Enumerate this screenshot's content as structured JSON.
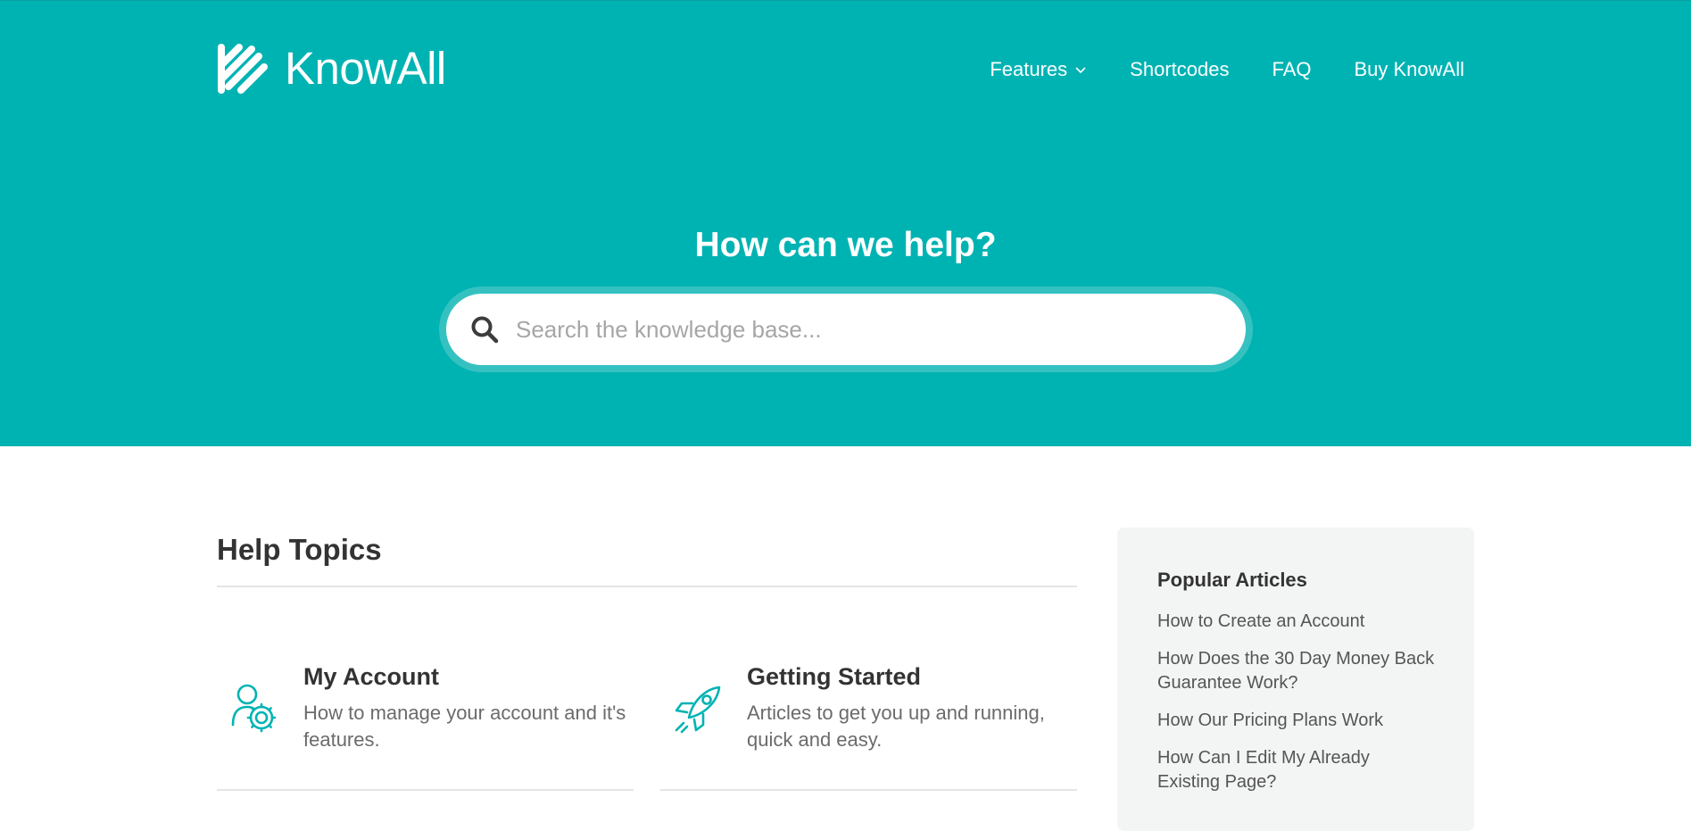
{
  "brand": {
    "name": "KnowAll",
    "color": "#00b3b3"
  },
  "nav": {
    "items": [
      {
        "label": "Features",
        "has_dropdown": true
      },
      {
        "label": "Shortcodes"
      },
      {
        "label": "FAQ"
      },
      {
        "label": "Buy KnowAll"
      }
    ]
  },
  "hero": {
    "title": "How can we help?",
    "search": {
      "placeholder": "Search the knowledge base...",
      "value": "",
      "icon": "search-icon"
    }
  },
  "topics": {
    "heading": "Help Topics",
    "cards": [
      {
        "title": "My Account",
        "description": "How to manage your account and it's features.",
        "icon": "user-gear-icon"
      },
      {
        "title": "Getting Started",
        "description": "Articles to get you up and running, quick and easy.",
        "icon": "rocket-icon"
      }
    ]
  },
  "sidebar": {
    "title": "Popular Articles",
    "articles": [
      "How to Create an Account",
      "How Does the 30 Day Money Back Guarantee Work?",
      "How Our Pricing Plans Work",
      "How Can I Edit My Already Existing Page?"
    ]
  }
}
